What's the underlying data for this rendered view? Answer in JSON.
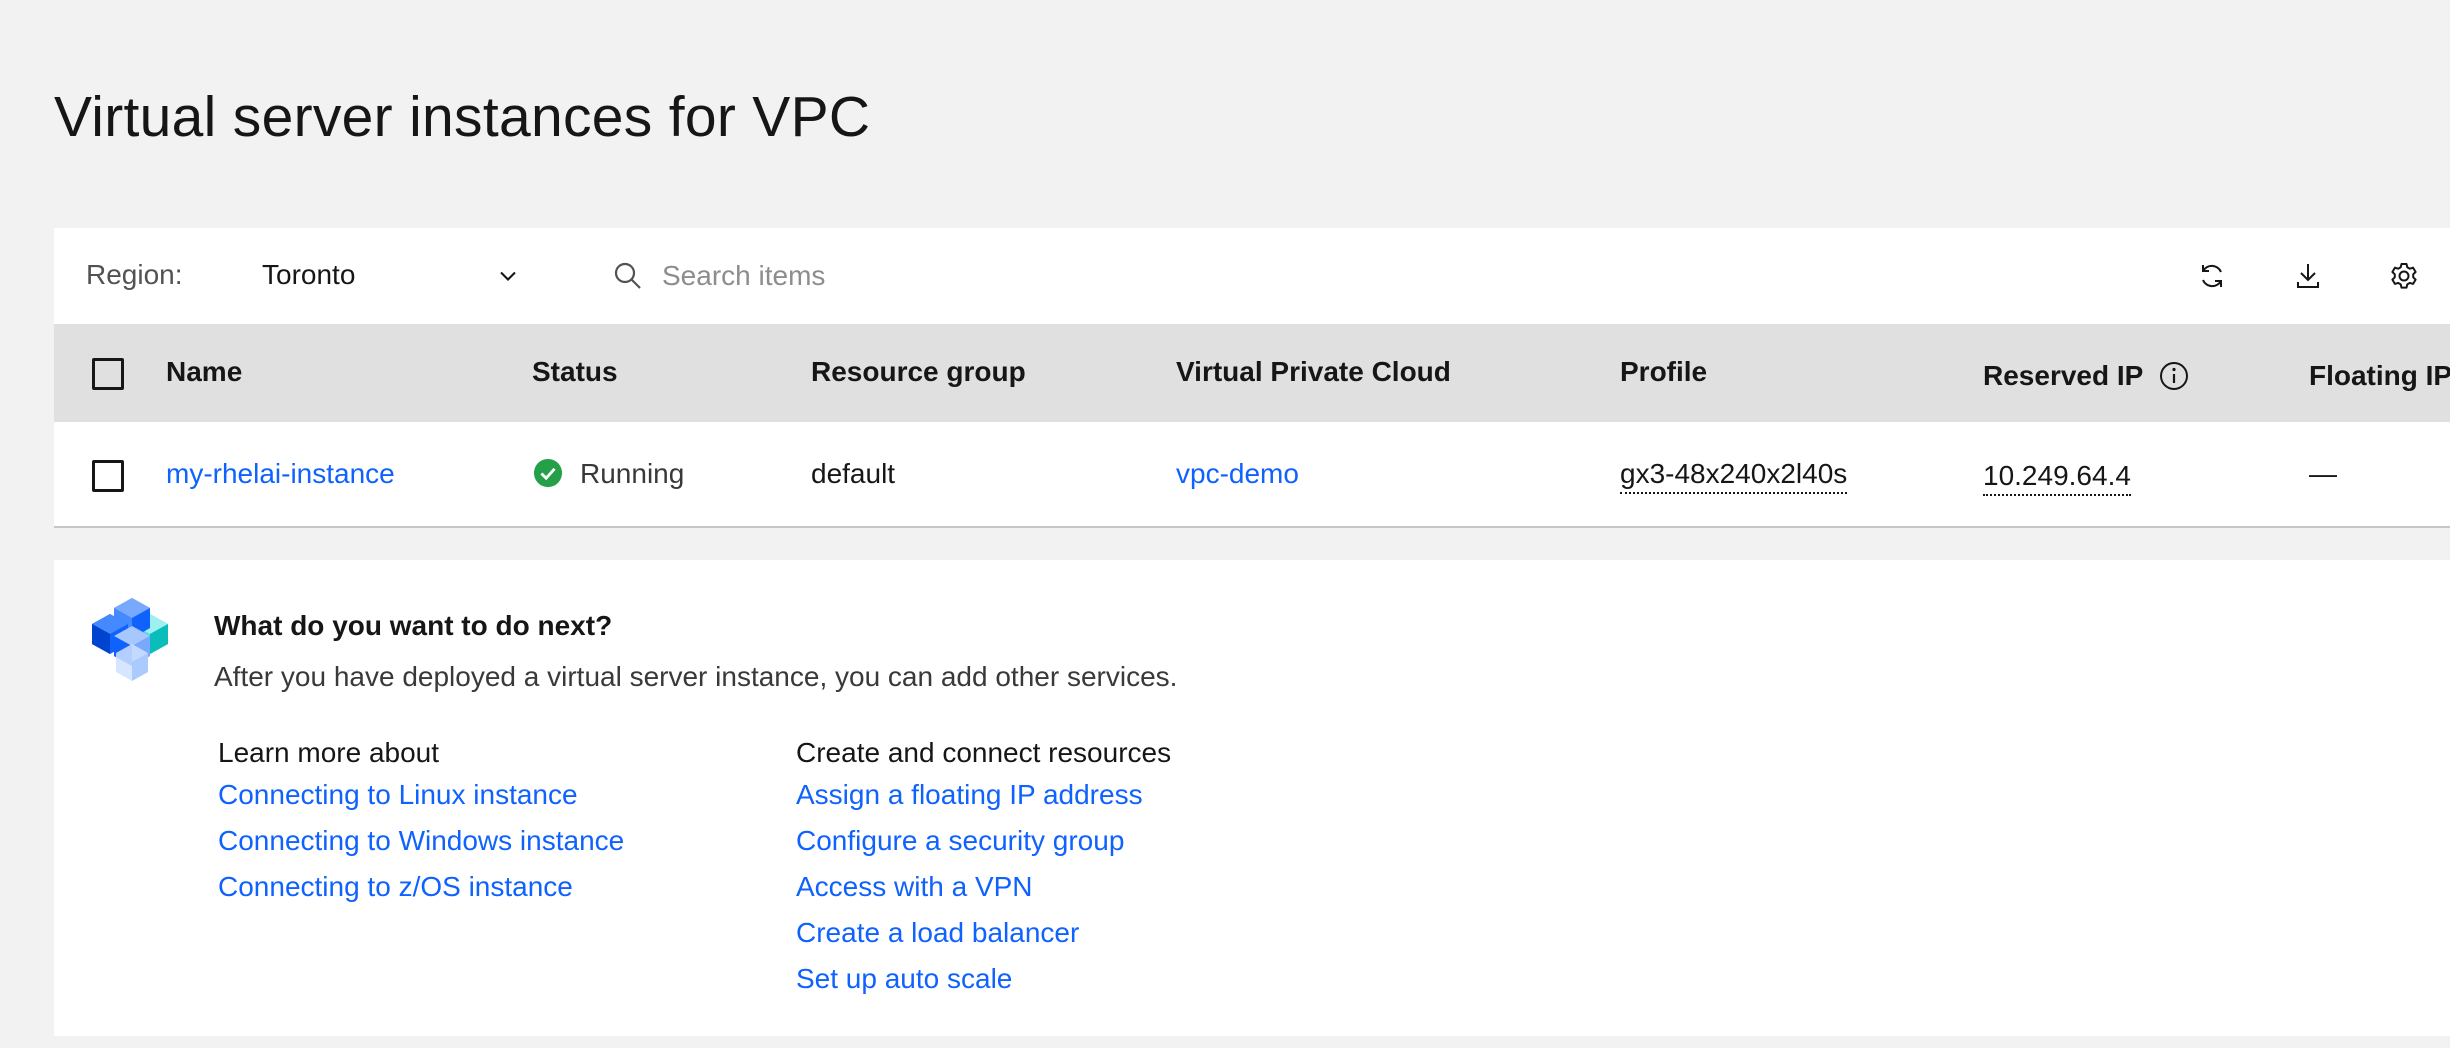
{
  "page": {
    "title": "Virtual server instances for VPC"
  },
  "toolbar": {
    "region_label": "Region:",
    "region_value": "Toronto",
    "search_placeholder": "Search items",
    "icons": [
      "refresh-icon",
      "download-icon",
      "settings-icon"
    ]
  },
  "table": {
    "columns": [
      "Name",
      "Status",
      "Resource group",
      "Virtual Private Cloud",
      "Profile",
      "Reserved IP",
      "Floating IP"
    ],
    "rows": [
      {
        "name": "my-rhelai-instance",
        "status": "Running",
        "resource_group": "default",
        "vpc": "vpc-demo",
        "profile": "gx3-48x240x2l40s",
        "reserved_ip": "10.249.64.4",
        "floating_ip": "—"
      }
    ]
  },
  "next_steps": {
    "title": "What do you want to do next?",
    "description": "After you have deployed a virtual server instance, you can add other services.",
    "learn_more": {
      "heading": "Learn more about",
      "links": [
        "Connecting to Linux instance",
        "Connecting to Windows instance",
        "Connecting to z/OS instance"
      ]
    },
    "create_connect": {
      "heading": "Create and connect resources",
      "links": [
        "Assign a floating IP address",
        "Configure a security group",
        "Access with a VPN",
        "Create a load balancer",
        "Set up auto scale"
      ]
    }
  },
  "colors": {
    "page_bg": "#f2f2f2",
    "header_bg": "#e0e0e0",
    "link": "#0f62fe",
    "status_ok": "#24a148",
    "text": "#161616"
  }
}
